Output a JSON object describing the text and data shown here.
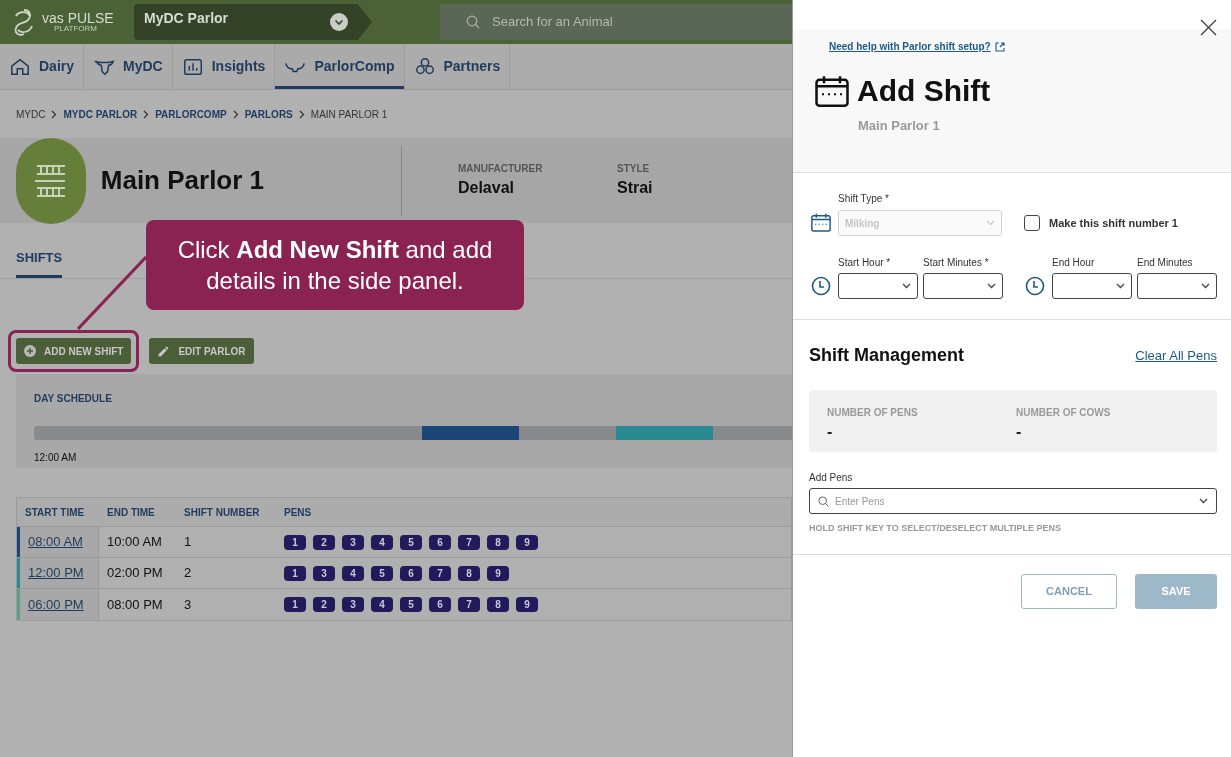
{
  "header": {
    "logo_text": "vas PULSE",
    "logo_subtext": "PLATFORM",
    "farm_selector": "MyDC Parlor",
    "search": {
      "placeholder": "Search for an Animal"
    }
  },
  "nav_tabs": [
    {
      "label": "Dairy",
      "kind": "home",
      "selected": false
    },
    {
      "label": "MyDC",
      "kind": "cow",
      "selected": false
    },
    {
      "label": "Insights",
      "kind": "chart",
      "selected": false
    },
    {
      "label": "ParlorComp",
      "kind": "horns",
      "selected": true
    },
    {
      "label": "Partners",
      "kind": "hexagons",
      "selected": false
    }
  ],
  "breadcrumb": [
    {
      "label": "MYDC",
      "link": false
    },
    {
      "label": "MYDC PARLOR",
      "link": true
    },
    {
      "label": "PARLORCOMP",
      "link": true
    },
    {
      "label": "PARLORS",
      "link": true
    },
    {
      "label": "MAIN PARLOR 1",
      "link": false
    }
  ],
  "parlor": {
    "title": "Main Parlor 1",
    "details": [
      {
        "label": "MANUFACTURER",
        "value": "Delaval"
      },
      {
        "label": "STYLE",
        "value": "Strai"
      }
    ]
  },
  "section_tabs": [
    {
      "label": "SHIFTS",
      "selected": true
    }
  ],
  "callout": {
    "text": "Click **Add New Shift** and add details in the side panel."
  },
  "actions": [
    {
      "label": "ADD NEW SHIFT",
      "kind": "add",
      "highlighted": true
    },
    {
      "label": "EDIT PARLOR",
      "kind": "edit",
      "highlighted": false
    }
  ],
  "day_schedule": {
    "title": "DAY SCHEDULE",
    "start_label": "12:00 AM"
  },
  "shifts_table": {
    "columns": [
      "START TIME",
      "END TIME",
      "SHIFT NUMBER",
      "PENS"
    ],
    "rows": [
      {
        "start": "08:00 AM",
        "end": "10:00 AM",
        "number": "1",
        "color": "#1c467a",
        "pens": [
          "1",
          "2",
          "3",
          "4",
          "5",
          "6",
          "7",
          "8",
          "9"
        ]
      },
      {
        "start": "12:00 PM",
        "end": "02:00 PM",
        "number": "2",
        "color": "#2a8a92",
        "pens": [
          "1",
          "3",
          "4",
          "5",
          "6",
          "7",
          "8",
          "9"
        ]
      },
      {
        "start": "06:00 PM",
        "end": "08:00 PM",
        "number": "3",
        "color": "#5b9e8a",
        "pens": [
          "1",
          "2",
          "3",
          "4",
          "5",
          "6",
          "7",
          "8",
          "9"
        ]
      }
    ]
  },
  "panel": {
    "help_link": "Need help with Parlor shift setup?",
    "title": "Add Shift",
    "subtitle": "Main Parlor 1",
    "shift_type": {
      "label": "Shift Type *",
      "value": "Milking",
      "disabled": true
    },
    "make_first": {
      "label": "Make this shift number 1",
      "checked": false
    },
    "time_groups": [
      {
        "fields": [
          "Start Hour *",
          "Start Minutes *"
        ]
      },
      {
        "fields": [
          "End Hour",
          "End Minutes"
        ]
      }
    ],
    "management": {
      "title": "Shift Management",
      "clear_link": "Clear All Pens",
      "stats": [
        {
          "label": "NUMBER OF PENS",
          "value": "-"
        },
        {
          "label": "NUMBER OF COWS",
          "value": "-"
        }
      ],
      "add_pens": {
        "label": "Add Pens",
        "placeholder": "Enter Pens",
        "hint": "HOLD SHIFT KEY TO SELECT/DESELECT MULTIPLE PENS"
      }
    },
    "buttons": [
      {
        "label": "CANCEL",
        "kind": "secondary",
        "disabled": false
      },
      {
        "label": "SAVE",
        "kind": "primary",
        "disabled": true
      }
    ]
  }
}
